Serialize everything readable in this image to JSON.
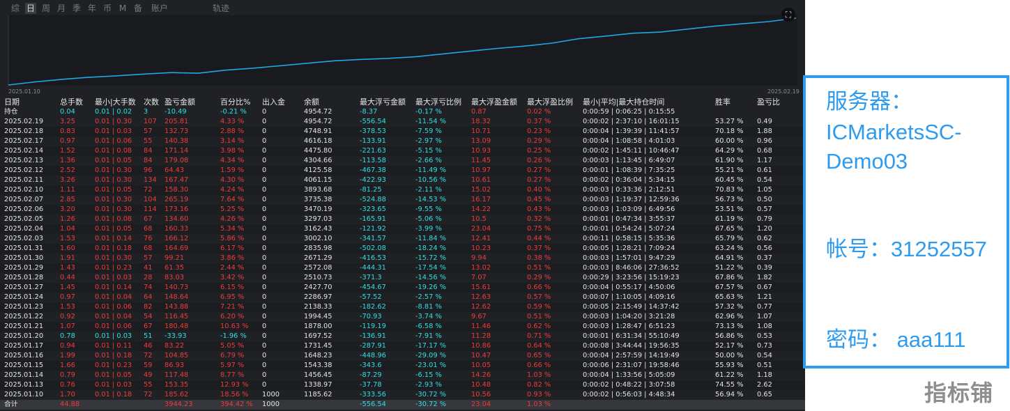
{
  "tabs": [
    {
      "label": "综",
      "active": false
    },
    {
      "label": "日",
      "active": true
    },
    {
      "label": "周",
      "active": false
    },
    {
      "label": "月",
      "active": false
    },
    {
      "label": "季",
      "active": false
    },
    {
      "label": "年",
      "active": false
    },
    {
      "label": "币",
      "active": false
    },
    {
      "label": "M",
      "active": false
    },
    {
      "label": "备",
      "active": false
    },
    {
      "label": "账户",
      "active": false
    },
    {
      "label": "轨迹",
      "active": false
    }
  ],
  "chart": {
    "start_label": "2025.01.10",
    "end_label": "2025.02.19",
    "line_color": "#1fa8e8",
    "control_icon": "expand-icon",
    "control_glyph": "⛶"
  },
  "table": {
    "headers": [
      "日期",
      "总手数",
      "最小|大手数",
      "次数",
      "盈亏金额",
      "百分比%",
      "出入金",
      "余额",
      "最大浮亏金额",
      "最大浮亏比例",
      "最大浮盈金额",
      "最大浮盈比例",
      "最小|平均|最大持仓时间",
      "胜率",
      "盈亏比"
    ],
    "holding": {
      "label": "持仓",
      "lots": "0.04",
      "minmax": "0.01 | 0.02",
      "count": "3",
      "pnl": "-10.49",
      "pct": "-0.21 %",
      "inout": "0",
      "balance": "4954.72",
      "max_float_loss": "-8.37",
      "max_float_loss_pct": "-0.17 %",
      "max_float_profit": "0.87",
      "max_float_profit_pct": "0.02 %",
      "hold_time": "0:00:59 | 0:06:25 | 0:15:55",
      "win_rate": "",
      "pl_ratio": ""
    },
    "rows": [
      {
        "date": "2025.02.19",
        "lots": "3.25",
        "minmax": "0.01 | 0.30",
        "count": "107",
        "pnl": "205.81",
        "pct": "4.33 %",
        "inout": "0",
        "balance": "4954.72",
        "max_float_loss": "-556.54",
        "max_float_loss_pct": "-11.54 %",
        "max_float_profit": "18.32",
        "max_float_profit_pct": "0.37 %",
        "hold_time": "0:00:02 | 2:37:10 | 16:01:15",
        "win_rate": "53.27 %",
        "pl_ratio": "0.49"
      },
      {
        "date": "2025.02.18",
        "lots": "0.83",
        "minmax": "0.01 | 0.03",
        "count": "57",
        "pnl": "132.73",
        "pct": "2.88 %",
        "inout": "0",
        "balance": "4748.91",
        "max_float_loss": "-378.53",
        "max_float_loss_pct": "-7.59 %",
        "max_float_profit": "10.71",
        "max_float_profit_pct": "0.23 %",
        "hold_time": "0:00:04 | 1:39:39 | 11:41:57",
        "win_rate": "70.18 %",
        "pl_ratio": "1.88"
      },
      {
        "date": "2025.02.17",
        "lots": "0.97",
        "minmax": "0.01 | 0.06",
        "count": "55",
        "pnl": "140.38",
        "pct": "3.14 %",
        "inout": "0",
        "balance": "4616.18",
        "max_float_loss": "-133.91",
        "max_float_loss_pct": "-2.97 %",
        "max_float_profit": "13.09",
        "max_float_profit_pct": "0.29 %",
        "hold_time": "0:00:04 | 1:08:58 | 4:01:03",
        "win_rate": "60.00 %",
        "pl_ratio": "0.96"
      },
      {
        "date": "2025.02.14",
        "lots": "1.52",
        "minmax": "0.01 | 0.08",
        "count": "84",
        "pnl": "171.14",
        "pct": "3.98 %",
        "inout": "0",
        "balance": "4475.80",
        "max_float_loss": "-221.63",
        "max_float_loss_pct": "-5.15 %",
        "max_float_profit": "10.93",
        "max_float_profit_pct": "0.25 %",
        "hold_time": "0:00:02 | 1:45:11 | 10:46:47",
        "win_rate": "64.29 %",
        "pl_ratio": "0.68"
      },
      {
        "date": "2025.02.13",
        "lots": "1.36",
        "minmax": "0.01 | 0.05",
        "count": "84",
        "pnl": "179.08",
        "pct": "4.34 %",
        "inout": "0",
        "balance": "4304.66",
        "max_float_loss": "-113.58",
        "max_float_loss_pct": "-2.66 %",
        "max_float_profit": "11.45",
        "max_float_profit_pct": "0.26 %",
        "hold_time": "0:00:03 | 1:13:45 | 6:49:07",
        "win_rate": "61.90 %",
        "pl_ratio": "1.17"
      },
      {
        "date": "2025.02.12",
        "lots": "2.52",
        "minmax": "0.01 | 0.30",
        "count": "96",
        "pnl": "64.43",
        "pct": "1.59 %",
        "inout": "0",
        "balance": "4125.58",
        "max_float_loss": "-467.38",
        "max_float_loss_pct": "-11.49 %",
        "max_float_profit": "10.97",
        "max_float_profit_pct": "0.27 %",
        "hold_time": "0:00:01 | 1:08:39 | 7:35:25",
        "win_rate": "55.21 %",
        "pl_ratio": "0.61"
      },
      {
        "date": "2025.02.11",
        "lots": "3.26",
        "minmax": "0.01 | 0.30",
        "count": "134",
        "pnl": "167.47",
        "pct": "4.30 %",
        "inout": "0",
        "balance": "4061.15",
        "max_float_loss": "-422.93",
        "max_float_loss_pct": "-10.56 %",
        "max_float_profit": "10.61",
        "max_float_profit_pct": "0.27 %",
        "hold_time": "0:00:02 | 0:36:04 | 5:34:15",
        "win_rate": "60.45 %",
        "pl_ratio": "0.54"
      },
      {
        "date": "2025.02.10",
        "lots": "1.11",
        "minmax": "0.01 | 0.05",
        "count": "72",
        "pnl": "158.30",
        "pct": "4.24 %",
        "inout": "0",
        "balance": "3893.68",
        "max_float_loss": "-81.25",
        "max_float_loss_pct": "-2.11 %",
        "max_float_profit": "15.02",
        "max_float_profit_pct": "0.40 %",
        "hold_time": "0:00:03 | 0:33:36 | 2:12:51",
        "win_rate": "70.83 %",
        "pl_ratio": "1.05"
      },
      {
        "date": "2025.02.07",
        "lots": "2.85",
        "minmax": "0.01 | 0.30",
        "count": "104",
        "pnl": "265.19",
        "pct": "7.64 %",
        "inout": "0",
        "balance": "3735.38",
        "max_float_loss": "-524.88",
        "max_float_loss_pct": "-14.53 %",
        "max_float_profit": "16.17",
        "max_float_profit_pct": "0.45 %",
        "hold_time": "0:00:03 | 1:19:37 | 12:59:36",
        "win_rate": "56.73 %",
        "pl_ratio": "0.50"
      },
      {
        "date": "2025.02.06",
        "lots": "3.20",
        "minmax": "0.01 | 0.30",
        "count": "114",
        "pnl": "173.16",
        "pct": "5.25 %",
        "inout": "0",
        "balance": "3470.19",
        "max_float_loss": "-323.65",
        "max_float_loss_pct": "-9.55 %",
        "max_float_profit": "14.22",
        "max_float_profit_pct": "0.43 %",
        "hold_time": "0:00:03 | 1:03:09 | 6:49:56",
        "win_rate": "53.51 %",
        "pl_ratio": "0.57"
      },
      {
        "date": "2025.02.05",
        "lots": "1.26",
        "minmax": "0.01 | 0.08",
        "count": "67",
        "pnl": "134.60",
        "pct": "4.26 %",
        "inout": "0",
        "balance": "3297.03",
        "max_float_loss": "-165.91",
        "max_float_loss_pct": "-5.06 %",
        "max_float_profit": "10.5",
        "max_float_profit_pct": "0.32 %",
        "hold_time": "0:00:01 | 0:47:34 | 3:55:37",
        "win_rate": "61.19 %",
        "pl_ratio": "0.79"
      },
      {
        "date": "2025.02.04",
        "lots": "1.04",
        "minmax": "0.01 | 0.05",
        "count": "68",
        "pnl": "160.33",
        "pct": "5.34 %",
        "inout": "0",
        "balance": "3162.43",
        "max_float_loss": "-121.92",
        "max_float_loss_pct": "-3.99 %",
        "max_float_profit": "23.04",
        "max_float_profit_pct": "0.75 %",
        "hold_time": "0:00:01 | 0:54:24 | 5:07:24",
        "win_rate": "67.65 %",
        "pl_ratio": "1.20"
      },
      {
        "date": "2025.02.03",
        "lots": "1.53",
        "minmax": "0.01 | 0.14",
        "count": "76",
        "pnl": "166.12",
        "pct": "5.86 %",
        "inout": "0",
        "balance": "3002.10",
        "max_float_loss": "-341.57",
        "max_float_loss_pct": "-11.84 %",
        "max_float_profit": "12.41",
        "max_float_profit_pct": "0.44 %",
        "hold_time": "0:00:11 | 0:58:15 | 5:35:36",
        "win_rate": "65.79 %",
        "pl_ratio": "0.62"
      },
      {
        "date": "2025.01.31",
        "lots": "1.60",
        "minmax": "0.01 | 0.18",
        "count": "68",
        "pnl": "164.69",
        "pct": "6.17 %",
        "inout": "0",
        "balance": "2835.98",
        "max_float_loss": "-502.08",
        "max_float_loss_pct": "-18.24 %",
        "max_float_profit": "10.23",
        "max_float_profit_pct": "0.37 %",
        "hold_time": "0:00:05 | 1:28:21 | 7:09:24",
        "win_rate": "63.24 %",
        "pl_ratio": "0.56"
      },
      {
        "date": "2025.01.30",
        "lots": "1.91",
        "minmax": "0.01 | 0.30",
        "count": "57",
        "pnl": "99.21",
        "pct": "3.86 %",
        "inout": "0",
        "balance": "2671.29",
        "max_float_loss": "-416.53",
        "max_float_loss_pct": "-15.72 %",
        "max_float_profit": "9.94",
        "max_float_profit_pct": "0.38 %",
        "hold_time": "0:00:03 | 1:57:01 | 9:47:29",
        "win_rate": "64.91 %",
        "pl_ratio": "0.37"
      },
      {
        "date": "2025.01.29",
        "lots": "1.43",
        "minmax": "0.01 | 0.23",
        "count": "41",
        "pnl": "61.35",
        "pct": "2.44 %",
        "inout": "0",
        "balance": "2572.08",
        "max_float_loss": "-444.31",
        "max_float_loss_pct": "-17.54 %",
        "max_float_profit": "13.02",
        "max_float_profit_pct": "0.51 %",
        "hold_time": "0:00:03 | 8:46:06 | 27:36:52",
        "win_rate": "51.22 %",
        "pl_ratio": "0.39"
      },
      {
        "date": "2025.01.28",
        "lots": "0.44",
        "minmax": "0.01 | 0.03",
        "count": "28",
        "pnl": "83.03",
        "pct": "3.42 %",
        "inout": "0",
        "balance": "2510.73",
        "max_float_loss": "-371.3",
        "max_float_loss_pct": "-14.56 %",
        "max_float_profit": "7.07",
        "max_float_profit_pct": "0.29 %",
        "hold_time": "0:00:29 | 3:23:56 | 15:19:23",
        "win_rate": "67.86 %",
        "pl_ratio": "1.82"
      },
      {
        "date": "2025.01.27",
        "lots": "1.45",
        "minmax": "0.01 | 0.14",
        "count": "74",
        "pnl": "140.73",
        "pct": "6.15 %",
        "inout": "0",
        "balance": "2427.70",
        "max_float_loss": "-454.67",
        "max_float_loss_pct": "-19.26 %",
        "max_float_profit": "15.61",
        "max_float_profit_pct": "0.66 %",
        "hold_time": "0:00:04 | 0:55:17 | 4:50:06",
        "win_rate": "67.57 %",
        "pl_ratio": "0.67"
      },
      {
        "date": "2025.01.24",
        "lots": "0.97",
        "minmax": "0.01 | 0.04",
        "count": "64",
        "pnl": "148.64",
        "pct": "6.95 %",
        "inout": "0",
        "balance": "2286.97",
        "max_float_loss": "-57.52",
        "max_float_loss_pct": "-2.57 %",
        "max_float_profit": "12.63",
        "max_float_profit_pct": "0.57 %",
        "hold_time": "0:00:07 | 1:10:05 | 4:09:16",
        "win_rate": "65.63 %",
        "pl_ratio": "1.21"
      },
      {
        "date": "2025.01.23",
        "lots": "1.53",
        "minmax": "0.01 | 0.06",
        "count": "82",
        "pnl": "143.88",
        "pct": "7.21 %",
        "inout": "0",
        "balance": "2138.33",
        "max_float_loss": "-182.62",
        "max_float_loss_pct": "-8.81 %",
        "max_float_profit": "12.62",
        "max_float_profit_pct": "0.59 %",
        "hold_time": "0:00:05 | 2:15:49 | 14:37:42",
        "win_rate": "57.32 %",
        "pl_ratio": "0.77"
      },
      {
        "date": "2025.01.22",
        "lots": "0.92",
        "minmax": "0.01 | 0.04",
        "count": "54",
        "pnl": "116.45",
        "pct": "6.20 %",
        "inout": "0",
        "balance": "1994.45",
        "max_float_loss": "-70.93",
        "max_float_loss_pct": "-3.74 %",
        "max_float_profit": "9.67",
        "max_float_profit_pct": "0.51 %",
        "hold_time": "0:00:03 | 1:04:20 | 3:21:28",
        "win_rate": "62.96 %",
        "pl_ratio": "1.07"
      },
      {
        "date": "2025.01.21",
        "lots": "1.07",
        "minmax": "0.01 | 0.06",
        "count": "67",
        "pnl": "180.48",
        "pct": "10.63 %",
        "inout": "0",
        "balance": "1878.00",
        "max_float_loss": "-119.19",
        "max_float_loss_pct": "-6.58 %",
        "max_float_profit": "11.46",
        "max_float_profit_pct": "0.62 %",
        "hold_time": "0:00:03 | 1:28:47 | 6:51:23",
        "win_rate": "73.13 %",
        "pl_ratio": "1.08"
      },
      {
        "date": "2025.01.20",
        "lots": "0.78",
        "minmax": "0.01 | 0.03",
        "count": "51",
        "pnl": "-33.93",
        "pct": "-1.96 %",
        "inout": "0",
        "balance": "1697.52",
        "max_float_loss": "-136.91",
        "max_float_loss_pct": "-7.91 %",
        "max_float_profit": "11.28",
        "max_float_profit_pct": "0.71 %",
        "hold_time": "0:00:01 | 6:31:34 | 55:10:49",
        "win_rate": "56.86 %",
        "pl_ratio": "0.53"
      },
      {
        "date": "2025.01.17",
        "lots": "0.94",
        "minmax": "0.01 | 0.11",
        "count": "46",
        "pnl": "83.22",
        "pct": "5.05 %",
        "inout": "0",
        "balance": "1731.45",
        "max_float_loss": "-287.91",
        "max_float_loss_pct": "-17.17 %",
        "max_float_profit": "10.86",
        "max_float_profit_pct": "0.64 %",
        "hold_time": "0:00:08 | 3:44:44 | 19:56:35",
        "win_rate": "52.17 %",
        "pl_ratio": "0.73"
      },
      {
        "date": "2025.01.16",
        "lots": "1.99",
        "minmax": "0.01 | 0.18",
        "count": "72",
        "pnl": "104.85",
        "pct": "6.79 %",
        "inout": "0",
        "balance": "1648.23",
        "max_float_loss": "-448.96",
        "max_float_loss_pct": "-29.09 %",
        "max_float_profit": "10.47",
        "max_float_profit_pct": "0.65 %",
        "hold_time": "0:00:04 | 2:57:59 | 14:19:49",
        "win_rate": "50.00 %",
        "pl_ratio": "0.54"
      },
      {
        "date": "2025.01.15",
        "lots": "1.66",
        "minmax": "0.01 | 0.23",
        "count": "59",
        "pnl": "86.93",
        "pct": "5.97 %",
        "inout": "0",
        "balance": "1543.38",
        "max_float_loss": "-343.6",
        "max_float_loss_pct": "-23.01 %",
        "max_float_profit": "10.05",
        "max_float_profit_pct": "0.66 %",
        "hold_time": "0:00:06 | 2:31:07 | 19:58:46",
        "win_rate": "55.93 %",
        "pl_ratio": "0.51"
      },
      {
        "date": "2025.01.14",
        "lots": "0.79",
        "minmax": "0.01 | 0.05",
        "count": "49",
        "pnl": "117.48",
        "pct": "8.77 %",
        "inout": "0",
        "balance": "1456.45",
        "max_float_loss": "-87.29",
        "max_float_loss_pct": "-6.15 %",
        "max_float_profit": "14.26",
        "max_float_profit_pct": "1.03 %",
        "hold_time": "0:00:04 | 1:33:56 | 5:05:09",
        "win_rate": "61.22 %",
        "pl_ratio": "1.18"
      },
      {
        "date": "2025.01.13",
        "lots": "0.76",
        "minmax": "0.01 | 0.03",
        "count": "55",
        "pnl": "153.35",
        "pct": "12.93 %",
        "inout": "0",
        "balance": "1338.97",
        "max_float_loss": "-37.78",
        "max_float_loss_pct": "-2.93 %",
        "max_float_profit": "10.48",
        "max_float_profit_pct": "0.82 %",
        "hold_time": "0:00:02 | 0:48:22 | 3:07:58",
        "win_rate": "74.55 %",
        "pl_ratio": "2.62"
      },
      {
        "date": "2025.01.10",
        "lots": "1.70",
        "minmax": "0.01 | 0.18",
        "count": "72",
        "pnl": "185.62",
        "pct": "18.56 %",
        "inout": "1000",
        "balance": "1185.62",
        "max_float_loss": "-333.56",
        "max_float_loss_pct": "-30.72 %",
        "max_float_profit": "10.56",
        "max_float_profit_pct": "0.93 %",
        "hold_time": "0:00:02 | 0:56:03 | 4:48:34",
        "win_rate": "56.94 %",
        "pl_ratio": "0.65"
      }
    ],
    "total": {
      "label": "合计",
      "lots": "44.88",
      "pnl": "3944.23",
      "pct": "394.42 %",
      "inout": "1000",
      "max_float_loss": "-556.54",
      "max_float_loss_pct": "-30.72 %",
      "max_float_profit": "23.04",
      "max_float_profit_pct": "1.03 %"
    }
  },
  "info_box": {
    "server_label": "服务器：",
    "server_line1": "ICMarketsSC-",
    "server_line2": "Demo03",
    "account": "帐号：31252557",
    "password": "密码：  aaa111",
    "border_color": "#2d9bf0"
  },
  "watermark": "指标铺"
}
